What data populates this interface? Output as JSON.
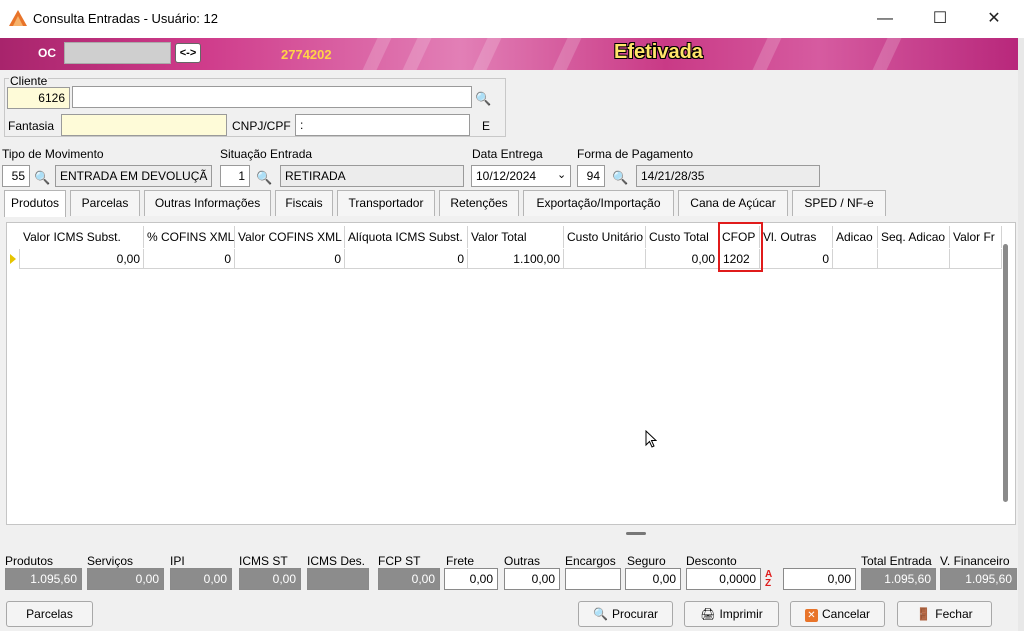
{
  "window": {
    "title": "Consulta Entradas - Usuário: 12",
    "minimize": "—",
    "maximize": "☐",
    "close": "✕"
  },
  "banner": {
    "oc_label": "OC",
    "swap_label": "<->",
    "number": "2774202",
    "status": "Efetivada"
  },
  "cliente": {
    "label": "Cliente",
    "code": "6126",
    "name": "",
    "fantasia_label": "Fantasia",
    "fantasia": "",
    "cnpj_label": "CNPJ/CPF",
    "cnpj": ":",
    "e_label": "E"
  },
  "movimento": {
    "tipo_label": "Tipo  de Movimento",
    "tipo_code": "55",
    "tipo_desc": "ENTRADA EM DEVOLUÇÃ",
    "situacao_label": "Situação Entrada",
    "situacao_code": "1",
    "situacao_desc": "RETIRADA",
    "data_label": "Data Entrega",
    "data": "10/12/2024",
    "forma_label": "Forma de Pagamento",
    "forma_code": "94",
    "forma_desc": "14/21/28/35"
  },
  "tabs": [
    "Produtos",
    "Parcelas",
    "Outras Informações",
    "Fiscais",
    "Transportador",
    "Retenções",
    "Exportação/Importação",
    "Cana de Açúcar",
    "SPED / NF-e"
  ],
  "grid": {
    "headers": [
      "Valor ICMS Subst.",
      "% COFINS XML",
      "Valor COFINS XML",
      "Alíquota ICMS Subst.",
      "Valor Total",
      "Custo Unitário",
      "Custo Total",
      "CFOP",
      "Vl. Outras",
      "Adicao",
      "Seq. Adicao",
      "Valor Fr"
    ],
    "row": [
      "0,00",
      "0",
      "0",
      "0",
      "1.100,00",
      "",
      "0,00",
      "1202",
      "0",
      "",
      "",
      ""
    ]
  },
  "totals": {
    "produtos_label": "Produtos",
    "produtos": "1.095,60",
    "servicos_label": "Serviços",
    "servicos": "0,00",
    "ipi_label": "IPI",
    "ipi": "0,00",
    "icms_st_label": "ICMS ST",
    "icms_st": "0,00",
    "icms_des_label": "ICMS Des.",
    "icms_des": "",
    "fcp_st_label": "FCP ST",
    "fcp_st": "0,00",
    "frete_label": "Frete",
    "frete": "0,00",
    "outras_label": "Outras",
    "outras": "0,00",
    "encargos_label": "Encargos",
    "encargos": "",
    "seguro_label": "Seguro",
    "seguro": "0,00",
    "desconto_label": "Desconto",
    "desconto_pct": "0,0000",
    "desconto": "0,00",
    "total_entrada_label": "Total Entrada",
    "total_entrada": "1.095,60",
    "v_financeiro_label": "V. Financeiro",
    "v_financeiro": "1.095,60"
  },
  "buttons": {
    "parcelas": "Parcelas",
    "procurar": "Procurar",
    "imprimir": "Imprimir",
    "cancelar": "Cancelar",
    "fechar": "Fechar"
  },
  "colors": {
    "banner": "#c93a86",
    "status_text": "#ffe46a",
    "highlight": "#e01b1b"
  }
}
